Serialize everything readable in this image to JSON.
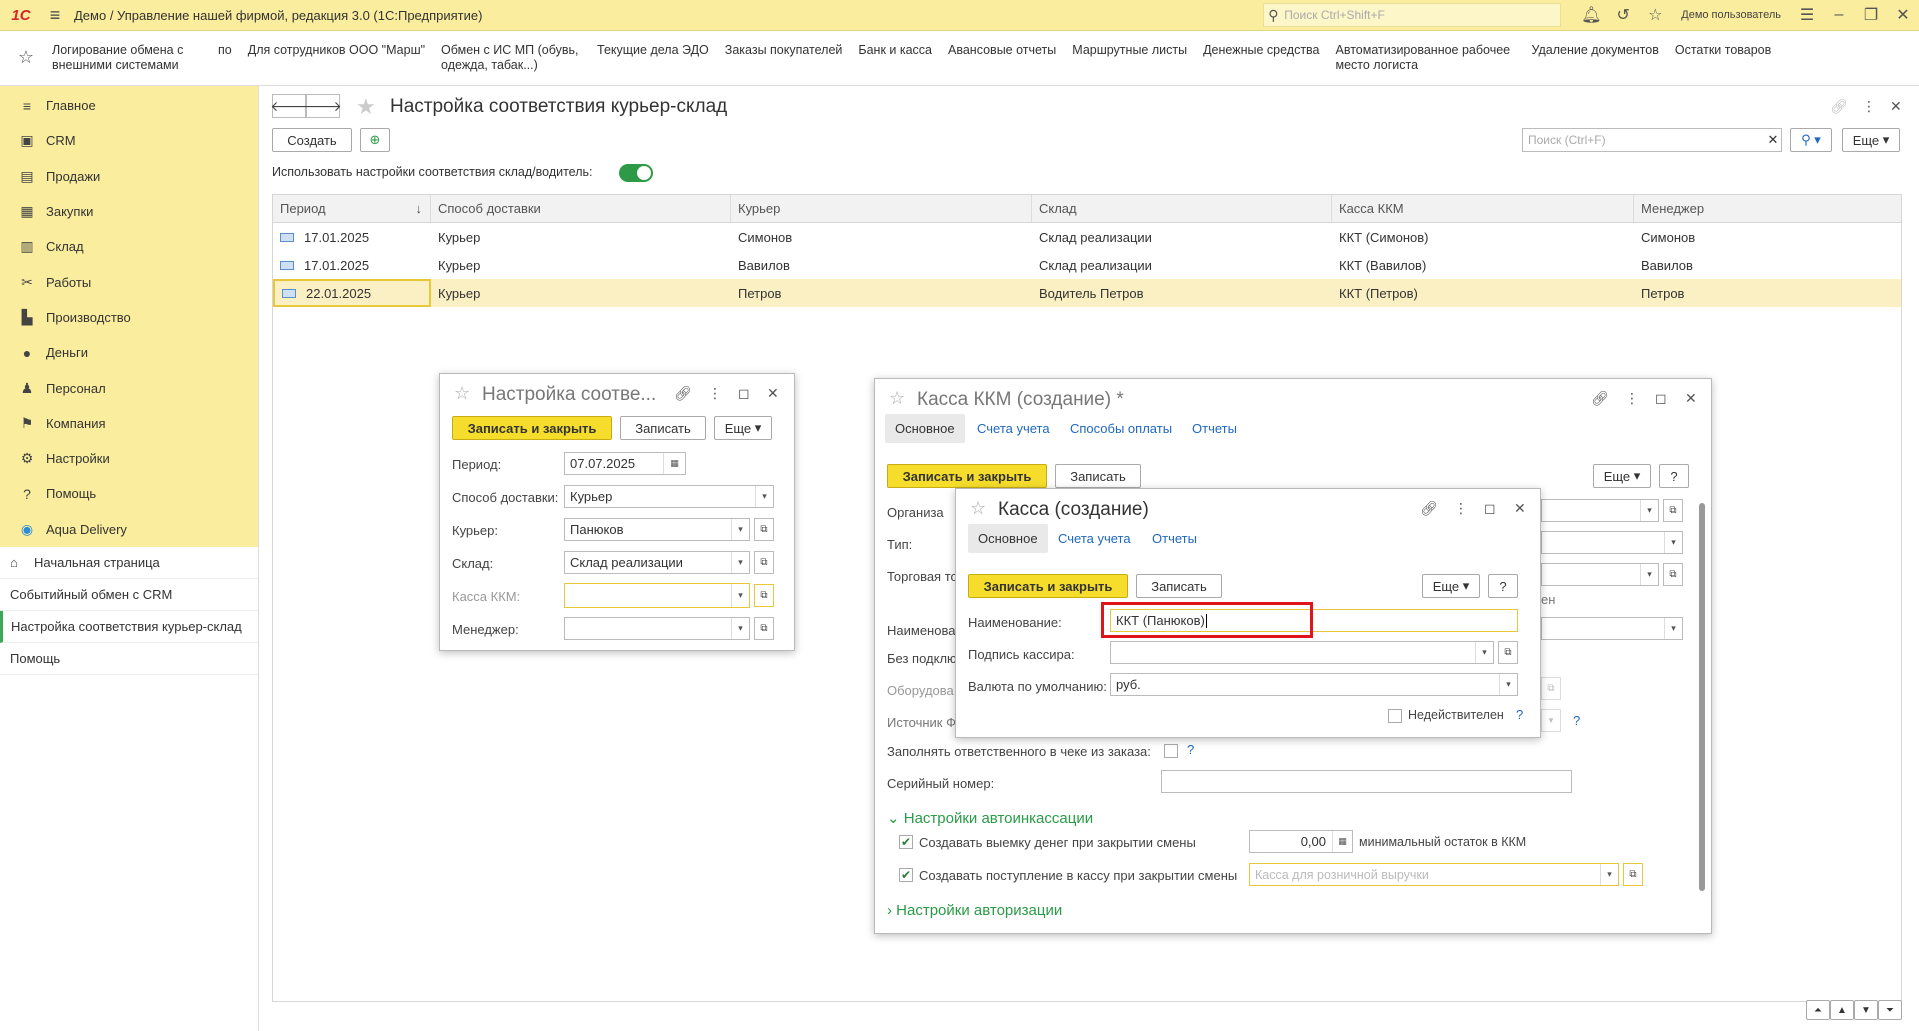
{
  "titlebar": {
    "logo": "1С",
    "title": "Демо / Управление нашей фирмой, редакция 3.0  (1С:Предприятие)",
    "search_placeholder": "Поиск Ctrl+Shift+F",
    "user": "Демо пользователь"
  },
  "quickbar": [
    "Логирование обмена с внешними системами",
    "по",
    "Для сотрудников ООО \"Марш\"",
    "Обмен с ИС МП (обувь, одежда, табак...)",
    "Текущие дела ЭДО",
    "Заказы покупателей",
    "Банк и касса",
    "Авансовые отчеты",
    "Маршрутные листы",
    "Денежные средства",
    "Автоматизированное рабочее место логиста",
    "Удаление документов",
    "Остатки товаров"
  ],
  "sidebar": {
    "sections": [
      {
        "label": "Главное",
        "icon": "≡"
      },
      {
        "label": "CRM",
        "icon": "▣"
      },
      {
        "label": "Продажи",
        "icon": "▤"
      },
      {
        "label": "Закупки",
        "icon": "▦"
      },
      {
        "label": "Склад",
        "icon": "▥"
      },
      {
        "label": "Работы",
        "icon": "✂"
      },
      {
        "label": "Производство",
        "icon": "▙"
      },
      {
        "label": "Деньги",
        "icon": "●"
      },
      {
        "label": "Персонал",
        "icon": "♟"
      },
      {
        "label": "Компания",
        "icon": "⚑"
      },
      {
        "label": "Настройки",
        "icon": "⚙"
      },
      {
        "label": "Помощь",
        "icon": "?"
      },
      {
        "label": "Aqua Delivery",
        "icon": "◉"
      }
    ],
    "open": [
      {
        "label": "Начальная страница",
        "icon": "⌂"
      },
      {
        "label": "Событийный обмен с CRM"
      },
      {
        "label": "Настройка соответствия курьер-склад"
      },
      {
        "label": "Помощь"
      }
    ]
  },
  "main": {
    "title": "Настройка соответствия курьер-склад",
    "create": "Создать",
    "toggle_label": "Использовать настройки соответствия склад/водитель:",
    "toggle_on": true,
    "search_placeholder": "Поиск (Ctrl+F)",
    "more": "Еще",
    "columns": [
      "Период",
      "Способ доставки",
      "Курьер",
      "Склад",
      "Касса ККМ",
      "Менеджер"
    ],
    "rows": [
      [
        "17.01.2025",
        "Курьер",
        "Симонов",
        "Склад реализации",
        "ККТ (Симонов)",
        "Симонов"
      ],
      [
        "17.01.2025",
        "Курьер",
        "Вавилов",
        "Склад реализации",
        "ККТ (Вавилов)",
        "Вавилов"
      ],
      [
        "22.01.2025",
        "Курьер",
        "Петров",
        "Водитель Петров",
        "ККТ (Петров)",
        "Петров"
      ]
    ]
  },
  "win1": {
    "title": "Настройка соотве...",
    "save_close": "Записать и закрыть",
    "save": "Записать",
    "more": "Еще",
    "period_label": "Период:",
    "period": "07.07.2025",
    "delivery_label": "Способ доставки:",
    "delivery": "Курьер",
    "courier_label": "Курьер:",
    "courier": "Панюков",
    "warehouse_label": "Склад:",
    "warehouse": "Склад реализации",
    "kkm_label": "Касса ККМ:",
    "manager_label": "Менеджер:"
  },
  "win2": {
    "title": "Касса ККМ (создание) *",
    "tabs": [
      "Основное",
      "Счета учета",
      "Способы оплаты",
      "Отчеты"
    ],
    "save_close": "Записать и закрыть",
    "save": "Записать",
    "more": "Еще",
    "help": "?",
    "org_label": "Организа",
    "type_label": "Тип:",
    "trade_label": "Торговая то",
    "name_label": "Наименова",
    "nocon_label": "Без подклю",
    "equip_label": "Оборудова",
    "source_label": "Источник Ф",
    "partial_en": "ен",
    "fill_resp_label": "Заполнять ответственного в чеке из заказа:",
    "serial_label": "Серийный номер:",
    "auto_section": "Настройки автоинкассации",
    "withdraw_label": "Создавать выемку денег при закрытии смены",
    "withdraw_value": "0,00",
    "min_balance": "минимальный остаток в ККМ",
    "receipt_label": "Создавать поступление в кассу при закрытии смены",
    "receipt_placeholder": "Касса для розничной выручки",
    "auth_section": "Настройки авторизации"
  },
  "win3": {
    "title": "Касса (создание)",
    "tabs": [
      "Основное",
      "Счета учета",
      "Отчеты"
    ],
    "save_close": "Записать и закрыть",
    "save": "Записать",
    "more": "Еще",
    "help": "?",
    "name_label": "Наименование:",
    "name_value": "ККТ (Панюков)",
    "cashier_label": "Подпись кассира:",
    "currency_label": "Валюта по умолчанию:",
    "currency": "руб.",
    "invalid_label": "Недействителен",
    "q": "?"
  },
  "colors": {
    "accent_yellow": "#f6dd2c",
    "sidebar": "#fbed9e",
    "green": "#2a9b47",
    "highlight_red": "#e0141b"
  }
}
